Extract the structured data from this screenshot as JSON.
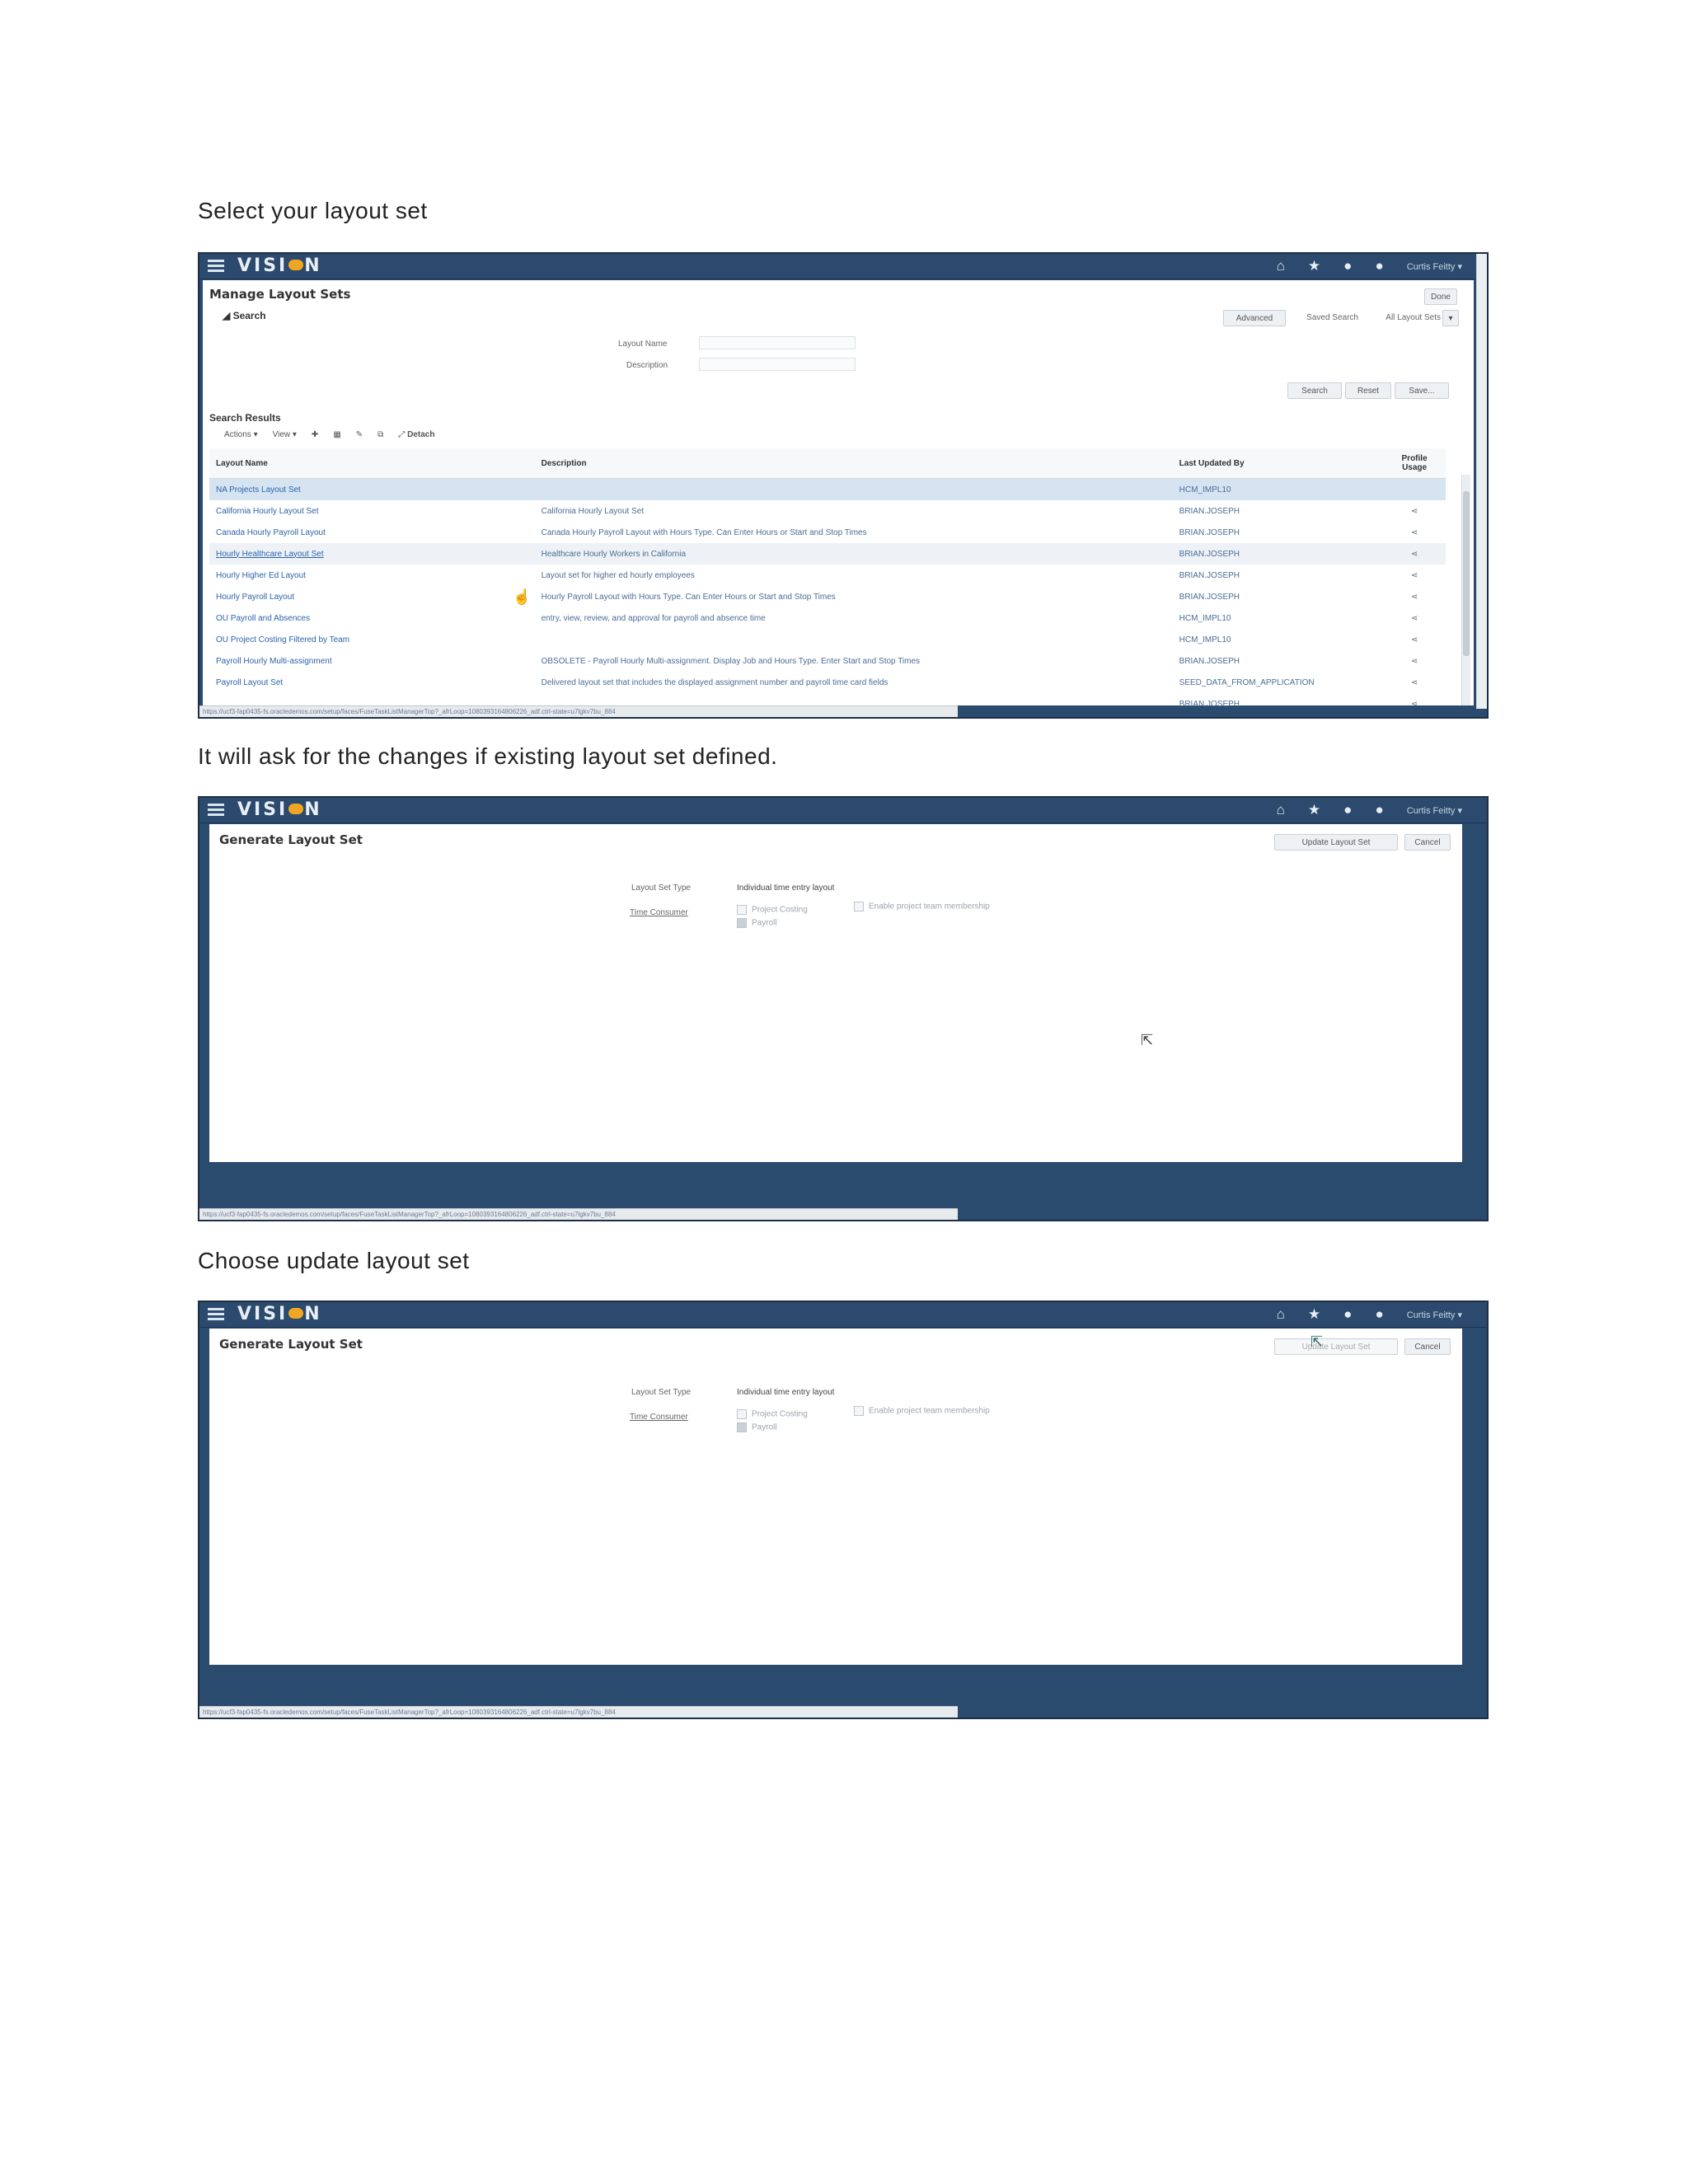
{
  "captions": [
    "Select your layout set",
    "It will ask for the changes if existing layout set defined.",
    "Choose update layout set"
  ],
  "app": {
    "logo": "VISION",
    "user": "Curtis Feitty"
  },
  "manage": {
    "title": "Manage Layout Sets",
    "done_label": "Done",
    "search_section": "Search",
    "advanced_label": "Advanced",
    "saved_search_label": "Saved Search",
    "saved_search_value": "All Layout Sets",
    "layout_name_label": "Layout Name",
    "description_label": "Description",
    "search_button": "Search",
    "reset_button": "Reset",
    "save_button": "Save...",
    "results_section": "Search Results",
    "actions_menu": "Actions",
    "view_menu": "View",
    "detach_label": "Detach",
    "columns": [
      "Layout Name",
      "Description",
      "Last Updated By",
      "Profile Usage"
    ],
    "rows": [
      {
        "name": "NA Projects Layout Set",
        "description": "",
        "by": "HCM_IMPL10"
      },
      {
        "name": "California Hourly Layout Set",
        "description": "California Hourly Layout Set",
        "by": "BRIAN.JOSEPH"
      },
      {
        "name": "Canada Hourly Payroll Layout",
        "description": "Canada Hourly Payroll Layout with Hours Type. Can Enter Hours or Start and Stop Times",
        "by": "BRIAN.JOSEPH"
      },
      {
        "name": "Hourly Healthcare Layout Set",
        "description": "Healthcare Hourly Workers in California",
        "by": "BRIAN.JOSEPH"
      },
      {
        "name": "Hourly Higher Ed Layout",
        "description": "Layout set for higher ed hourly employees",
        "by": "BRIAN.JOSEPH"
      },
      {
        "name": "Hourly Payroll Layout",
        "description": "Hourly Payroll Layout with Hours Type. Can Enter Hours or Start and Stop Times",
        "by": "BRIAN.JOSEPH"
      },
      {
        "name": "OU Payroll and Absences",
        "description": "entry, view, review, and approval for payroll and absence time",
        "by": "HCM_IMPL10"
      },
      {
        "name": "OU Project Costing Filtered by Team",
        "description": "",
        "by": "HCM_IMPL10"
      },
      {
        "name": "Payroll Hourly Multi-assignment",
        "description": "OBSOLETE - Payroll Hourly Multi-assignment. Display Job and Hours Type. Enter Start and Stop Times",
        "by": "BRIAN.JOSEPH"
      },
      {
        "name": "Payroll Layout Set",
        "description": "Delivered layout set that includes the displayed assignment number and payroll time card fields",
        "by": "SEED_DATA_FROM_APPLICATION"
      },
      {
        "name": "",
        "description": "",
        "by": "BRIAN.JOSEPH"
      }
    ],
    "status_url": "https://ucf3-fap0435-fs.oracledemos.com/setup/faces/FuseTaskListManagerTop?_afrLoop=1080393164806226_adf.ctrl-state=u7lgkv7bu_884"
  },
  "generate": {
    "title": "Generate Layout Set",
    "update_button": "Update Layout Set",
    "cancel_button": "Cancel",
    "type_label": "Layout Set Type",
    "type_value": "Individual time entry layout",
    "consumer_label": "Time Consumer",
    "project_costing": "Project Costing",
    "payroll": "Payroll",
    "enable_team": "Enable project team membership",
    "status_url": "https://ucf3-fap0435-fs.oracledemos.com/setup/faces/FuseTaskListManagerTop?_afrLoop=1080393164806226_adf.ctrl-state=u7lgkv7bu_884"
  },
  "icons": [
    "menu-icon",
    "home-icon",
    "star-icon",
    "notifications-icon",
    "help-icon",
    "chevron-down-icon",
    "add-icon",
    "delete-icon",
    "edit-icon",
    "export-icon",
    "detach-icon",
    "profile-usage-icon",
    "pointer-cursor-icon"
  ]
}
